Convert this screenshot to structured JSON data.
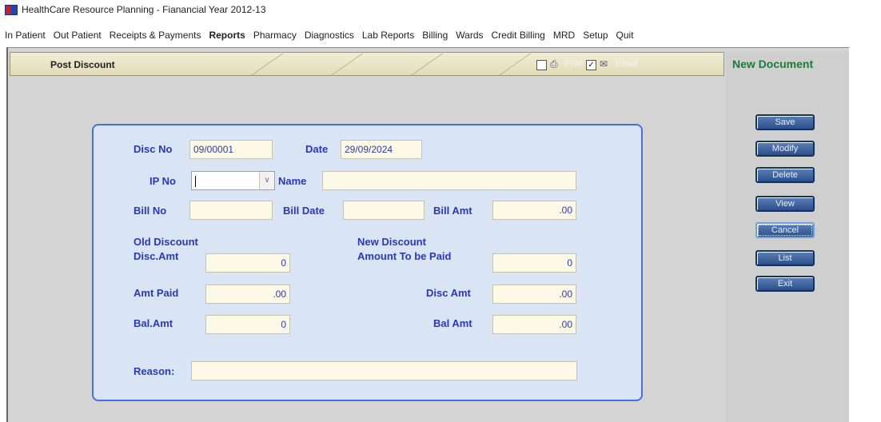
{
  "window": {
    "title": "HealthCare Resource Planning - Fianancial Year 2012-13"
  },
  "menu": [
    {
      "label": "In Patient",
      "active": false
    },
    {
      "label": "Out Patient",
      "active": false
    },
    {
      "label": "Receipts & Payments",
      "active": false
    },
    {
      "label": "Reports",
      "active": true
    },
    {
      "label": "Pharmacy",
      "active": false
    },
    {
      "label": "Diagnostics",
      "active": false
    },
    {
      "label": "Lab Reports",
      "active": false
    },
    {
      "label": "Billing",
      "active": false
    },
    {
      "label": "Wards",
      "active": false
    },
    {
      "label": "Credit Billing",
      "active": false
    },
    {
      "label": "MRD",
      "active": false
    },
    {
      "label": "Setup",
      "active": false
    },
    {
      "label": "Quit",
      "active": false
    }
  ],
  "toolbar": {
    "form_title": "Post Discount",
    "print_label": "Print",
    "email_label": "Email",
    "print_checked": false,
    "email_checked": true
  },
  "side": {
    "status": "New Document",
    "buttons": {
      "save": "Save",
      "modify": "Modify",
      "delete": "Delete",
      "view": "View",
      "cancel": "Cancel",
      "list": "List",
      "exit": "Exit"
    }
  },
  "form": {
    "disc_no": {
      "label": "Disc No",
      "value": "09/00001"
    },
    "date": {
      "label": "Date",
      "value": "29/09/2024"
    },
    "ip_no": {
      "label": "IP No",
      "value": ""
    },
    "name": {
      "label": "Name",
      "value": ""
    },
    "bill_no": {
      "label": "Bill No",
      "value": ""
    },
    "bill_date": {
      "label": "Bill Date",
      "value": ""
    },
    "bill_amt": {
      "label": "Bill Amt",
      "value": ".00"
    },
    "old_discount": {
      "heading": "Old Discount",
      "disc_amt": {
        "label": "Disc.Amt",
        "value": "0"
      },
      "amt_paid": {
        "label": "Amt Paid",
        "value": ".00"
      },
      "bal_amt": {
        "label": "Bal.Amt",
        "value": "0"
      }
    },
    "new_discount": {
      "heading": "New Discount",
      "amount_to_be_paid": {
        "label": "Amount To be Paid",
        "value": "0"
      },
      "disc_amt": {
        "label": "Disc Amt",
        "value": ".00"
      },
      "bal_amt": {
        "label": "Bal Amt",
        "value": ".00"
      }
    },
    "reason": {
      "label": "Reason:",
      "value": ""
    }
  },
  "colors": {
    "label_blue": "#2b38b8",
    "status_green": "#1e7a3a",
    "panel_border": "#4a6ee0"
  }
}
